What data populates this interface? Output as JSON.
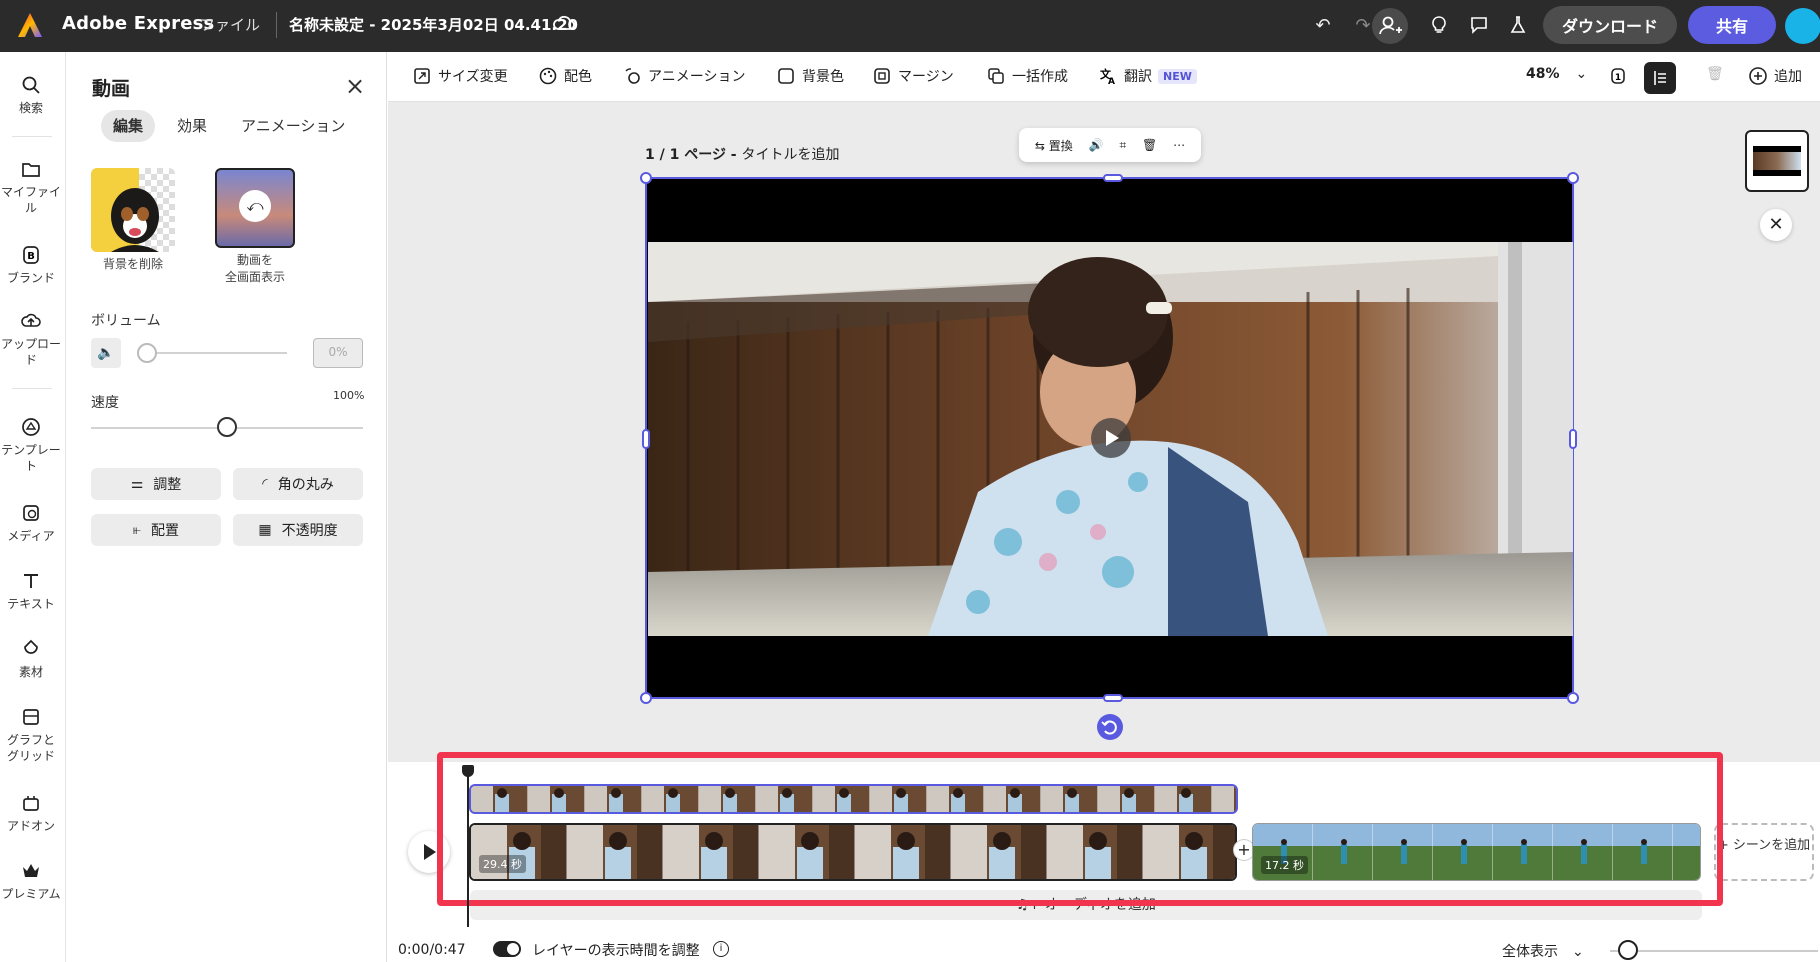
{
  "topbar": {
    "app_name": "Adobe Express",
    "file_menu": "ファイル",
    "doc_title": "名称未設定 - 2025年3月02日 04.41.20",
    "download_label": "ダウンロード",
    "share_label": "共有"
  },
  "rail": {
    "items": [
      {
        "label": "検索",
        "icon": "search-icon"
      },
      {
        "label": "マイファイル",
        "icon": "folder-icon"
      },
      {
        "label": "ブランド",
        "icon": "brand-icon"
      },
      {
        "label": "アップロード",
        "icon": "upload-icon"
      },
      {
        "label": "テンプレート",
        "icon": "template-icon"
      },
      {
        "label": "メディア",
        "icon": "media-icon"
      },
      {
        "label": "テキスト",
        "icon": "text-icon"
      },
      {
        "label": "素材",
        "icon": "elements-icon"
      },
      {
        "label": "グラフとグリッド",
        "icon": "grid-icon"
      },
      {
        "label": "アドオン",
        "icon": "addon-icon"
      },
      {
        "label": "プレミアム",
        "icon": "crown-icon"
      }
    ]
  },
  "panel": {
    "title": "動画",
    "tabs": [
      "編集",
      "効果",
      "アニメーション"
    ],
    "active_tab": "編集",
    "remove_bg_caption": "背景を削除",
    "fullscreen_caption_1": "動画を",
    "fullscreen_caption_2": "全画面表示",
    "volume_label": "ボリューム",
    "volume_value": "0%",
    "volume_level": 0,
    "speed_label": "速度",
    "speed_value": "100%",
    "speed_level": 0.5,
    "buttons": {
      "adjust": "調整",
      "corner": "角の丸み",
      "arrange": "配置",
      "opacity": "不透明度"
    }
  },
  "toolbar": {
    "resize": "サイズ変更",
    "color": "配色",
    "animation": "アニメーション",
    "bg_color": "背景色",
    "margin": "マージン",
    "batch": "一括作成",
    "translate": "翻訳",
    "translate_badge": "NEW",
    "zoom": "48%",
    "add": "追加"
  },
  "canvas": {
    "page_label": "1 / 1 ページ - ",
    "page_title_placeholder": "タイトルを追加",
    "float_replace": "置換"
  },
  "timeline": {
    "clip1_duration": "29.4 秒",
    "clip2_duration": "17.2 秒",
    "add_scene": "+ シーンを追加",
    "add_audio": "オーディオを追加",
    "timecode": "0:00/0:47",
    "layer_timing_label": "レイヤーの表示時間を調整",
    "zoom_all": "全体表示"
  },
  "colors": {
    "accent": "#5a5ae0",
    "highlight": "#f2354f",
    "topbar": "#2b2b2b"
  }
}
